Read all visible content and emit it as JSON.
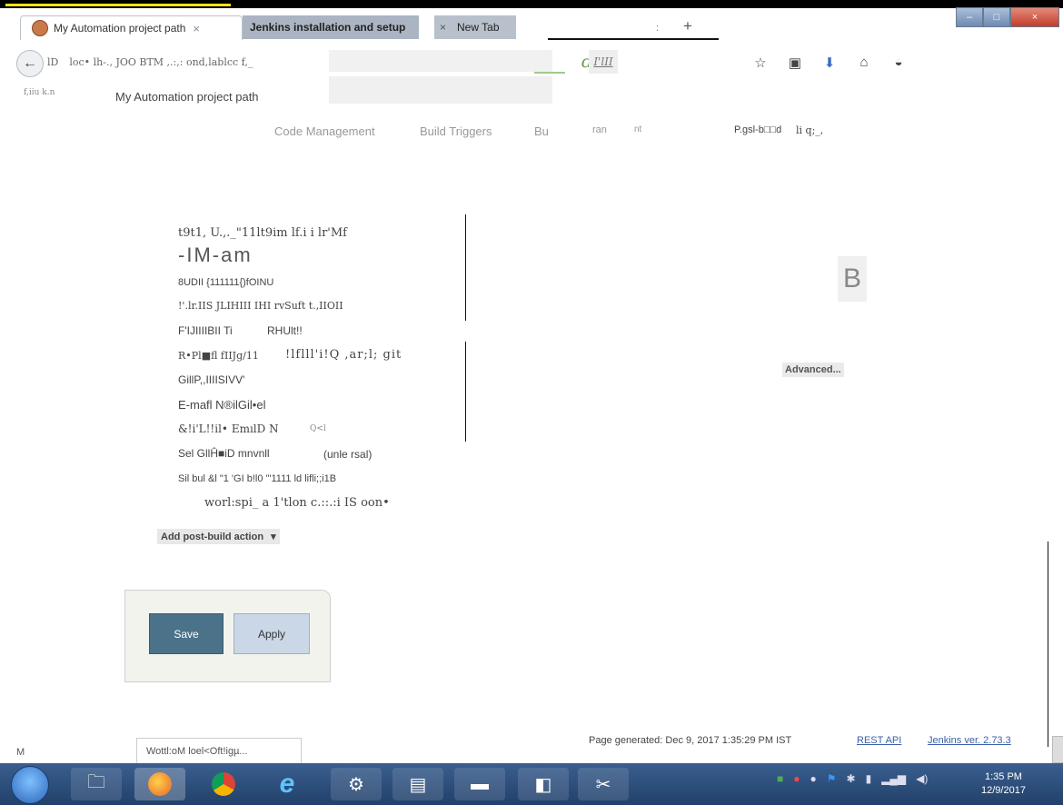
{
  "browser": {
    "tabs": [
      {
        "label": "My Automation project path",
        "close": "×"
      },
      {
        "label": "Jenkins installation and setup"
      },
      {
        "label": "New Tab",
        "close": "×"
      }
    ],
    "new_tab_dot": ":",
    "new_tab": "+",
    "window_controls": {
      "minimize": "–",
      "maximize": "□",
      "close": "×"
    },
    "back": "←",
    "url_bar": {
      "prefix": "lD",
      "text": "loc• lh-.,        JOO BTM ,.:,: ond,lablcc f,_",
      "suffix": "d!"
    },
    "search_fragment": "I'lII",
    "nav_icons": [
      "star-icon",
      "clipboard-icon",
      "download-icon",
      "home-icon",
      "pocket-icon"
    ]
  },
  "page": {
    "crumb_left": "f,iiu k.n",
    "crumb_title": "My Automation project path",
    "config_tabs": [
      "Code Management",
      "Build Triggers",
      "Bu",
      "ran",
      "nt",
      "P.gsl-b□□d",
      "li q;_,"
    ],
    "lines": [
      "t9t1, U.,._\"11lt9im lf.i i lr'Mf",
      "-IM-am",
      "8UDII  {111111{)fOINU",
      "!'.lr.IIS JLIHIII IHI rvSuft t.,IIOII",
      "F'IJIIIIBII Ti",
      "RHUlt!!",
      "R•Pl■fl fIIJg/11",
      "!lflll'i!Q ,ar;l; git",
      "GillP,,IIIISIVV'",
      "E-mafl N®ilGil•el",
      "&!i'L!!il• EmılD N",
      "Q<l",
      "Sel GllĤ■iD mnvnll",
      "(unle rsal)",
      "Sil  bul  &l       \"1 'GI     b!l0 \"'1111 ld lifli;;i1B",
      "worl:spi_ a 1'tlon  c.::.:i IS oon•"
    ],
    "help_letter": "B",
    "advanced_button": "Advanced...",
    "post_build_button": "Add post-build action",
    "post_build_caret": "▾",
    "save_button": "Save",
    "apply_button": "Apply"
  },
  "footer": {
    "generated": "Page generated: Dec 9, 2017 1:35:29 PM IST",
    "rest_api": "REST API",
    "version": "Jenkins ver. 2.73.3",
    "status_left": "M",
    "status_text": "Wottl:oM loel<Oft!igµ..."
  },
  "taskbar": {
    "apps": [
      "file-explorer-icon",
      "firefox-icon",
      "chrome-icon",
      "internet-explorer-icon",
      "settings-icon",
      "word-icon",
      "cmd-icon",
      "notepad-icon",
      "snipping-icon"
    ],
    "time": "1:35 PM",
    "date": "12/9/2017"
  },
  "colors": {
    "link": "#3a5fa8",
    "save": "#4a7289",
    "apply": "#cad7e6"
  }
}
